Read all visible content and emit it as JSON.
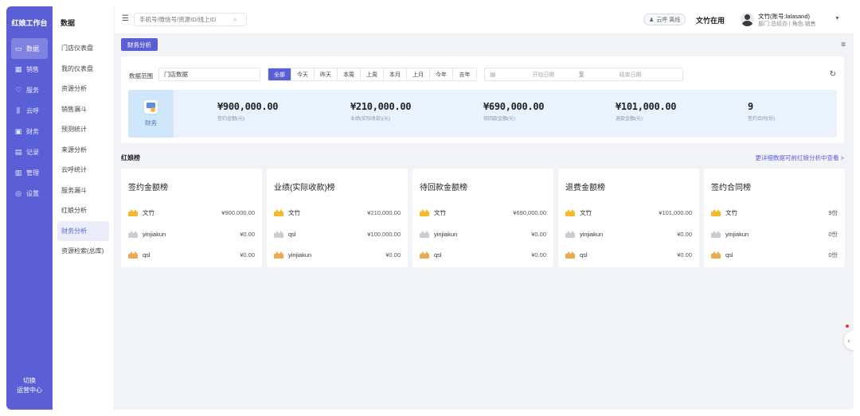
{
  "rail": {
    "title": "红娘工作台",
    "items": [
      {
        "label": "数据",
        "icon": "monitor-icon",
        "glyph": "▭",
        "active": true
      },
      {
        "label": "销售",
        "icon": "chart-icon",
        "glyph": "▦",
        "active": false
      },
      {
        "label": "服务",
        "icon": "heart-icon",
        "glyph": "♡",
        "active": false
      },
      {
        "label": "云呼",
        "icon": "bar-icon",
        "glyph": "⫼",
        "active": false
      },
      {
        "label": "财务",
        "icon": "wallet-icon",
        "glyph": "▣",
        "active": false
      },
      {
        "label": "记录",
        "icon": "doc-icon",
        "glyph": "▤",
        "active": false
      },
      {
        "label": "管理",
        "icon": "grid-icon",
        "glyph": "▥",
        "active": false
      },
      {
        "label": "设置",
        "icon": "gear-icon",
        "glyph": "◎",
        "active": false
      }
    ],
    "bottom_line1": "切换",
    "bottom_line2": "运营中心"
  },
  "subnav": {
    "title": "数据",
    "items": [
      {
        "label": "门店仪表盘",
        "active": false
      },
      {
        "label": "我的仪表盘",
        "active": false
      },
      {
        "label": "资源分析",
        "active": false
      },
      {
        "label": "销售漏斗",
        "active": false
      },
      {
        "label": "预测统计",
        "active": false
      },
      {
        "label": "来源分析",
        "active": false
      },
      {
        "label": "云呼统计",
        "active": false
      },
      {
        "label": "服务漏斗",
        "active": false
      },
      {
        "label": "红娘分析",
        "active": false
      },
      {
        "label": "财务分析",
        "active": true
      },
      {
        "label": "资源检索(总库)",
        "active": false
      }
    ]
  },
  "header": {
    "search_placeholder": "手机号/微信号/资源ID/线上ID",
    "cloud_status": "云呼 离线",
    "status": "文竹在用",
    "user_name": "文竹(账号:lalasand)",
    "user_sub": "部门:总经办 | 角色:销售"
  },
  "main": {
    "tab": "财务分析",
    "filter": {
      "range_label": "数据范围",
      "scope_value": "门店数据",
      "periods": [
        {
          "label": "全部",
          "active": true
        },
        {
          "label": "今天",
          "active": false
        },
        {
          "label": "昨天",
          "active": false
        },
        {
          "label": "本周",
          "active": false
        },
        {
          "label": "上周",
          "active": false
        },
        {
          "label": "本月",
          "active": false
        },
        {
          "label": "上月",
          "active": false
        },
        {
          "label": "今年",
          "active": false
        },
        {
          "label": "去年",
          "active": false
        }
      ],
      "start_placeholder": "开始日期",
      "to": "至",
      "end_placeholder": "结束日期"
    },
    "stats_badge": "财务",
    "stats": [
      {
        "value": "¥900,000.00",
        "caption": "签约金额(元)"
      },
      {
        "value": "¥210,000.00",
        "caption": "业绩(实际收款)(元)"
      },
      {
        "value": "¥690,000.00",
        "caption": "待回款金额(元)"
      },
      {
        "value": "¥101,000.00",
        "caption": "退款金额(元)"
      },
      {
        "value": "9",
        "caption": "签约合同(份)"
      }
    ],
    "section_title": "红娘榜",
    "section_link": "更详细数据可前红娘分析中查看 >",
    "colors": {
      "gold": "#f5b82e",
      "silver": "#c9ccd3",
      "bronze": "#f0a94a",
      "accent": "#5b5fd6"
    },
    "cards": [
      {
        "title": "签约金额榜",
        "rows": [
          {
            "name": "文竹",
            "amount": "¥900,000.00",
            "medal": "gold"
          },
          {
            "name": "yinjiakun",
            "amount": "¥0.00",
            "medal": "silver"
          },
          {
            "name": "qsl",
            "amount": "¥0.00",
            "medal": "bronze"
          }
        ]
      },
      {
        "title": "业绩(实际收款)榜",
        "rows": [
          {
            "name": "文竹",
            "amount": "¥210,000.00",
            "medal": "gold"
          },
          {
            "name": "qsl",
            "amount": "¥100,000.00",
            "medal": "silver"
          },
          {
            "name": "yinjiakun",
            "amount": "¥0.00",
            "medal": "bronze"
          }
        ]
      },
      {
        "title": "待回款金额榜",
        "rows": [
          {
            "name": "文竹",
            "amount": "¥690,000.00",
            "medal": "gold"
          },
          {
            "name": "yinjiakun",
            "amount": "¥0.00",
            "medal": "silver"
          },
          {
            "name": "qsl",
            "amount": "¥0.00",
            "medal": "bronze"
          }
        ]
      },
      {
        "title": "退费金额榜",
        "rows": [
          {
            "name": "文竹",
            "amount": "¥101,000.00",
            "medal": "gold"
          },
          {
            "name": "yinjiakun",
            "amount": "¥0.00",
            "medal": "silver"
          },
          {
            "name": "qsl",
            "amount": "¥0.00",
            "medal": "bronze"
          }
        ]
      },
      {
        "title": "签约合同榜",
        "rows": [
          {
            "name": "文竹",
            "amount": "9份",
            "medal": "gold"
          },
          {
            "name": "yinjiakun",
            "amount": "0份",
            "medal": "silver"
          },
          {
            "name": "qsl",
            "amount": "0份",
            "medal": "bronze"
          }
        ]
      }
    ]
  }
}
